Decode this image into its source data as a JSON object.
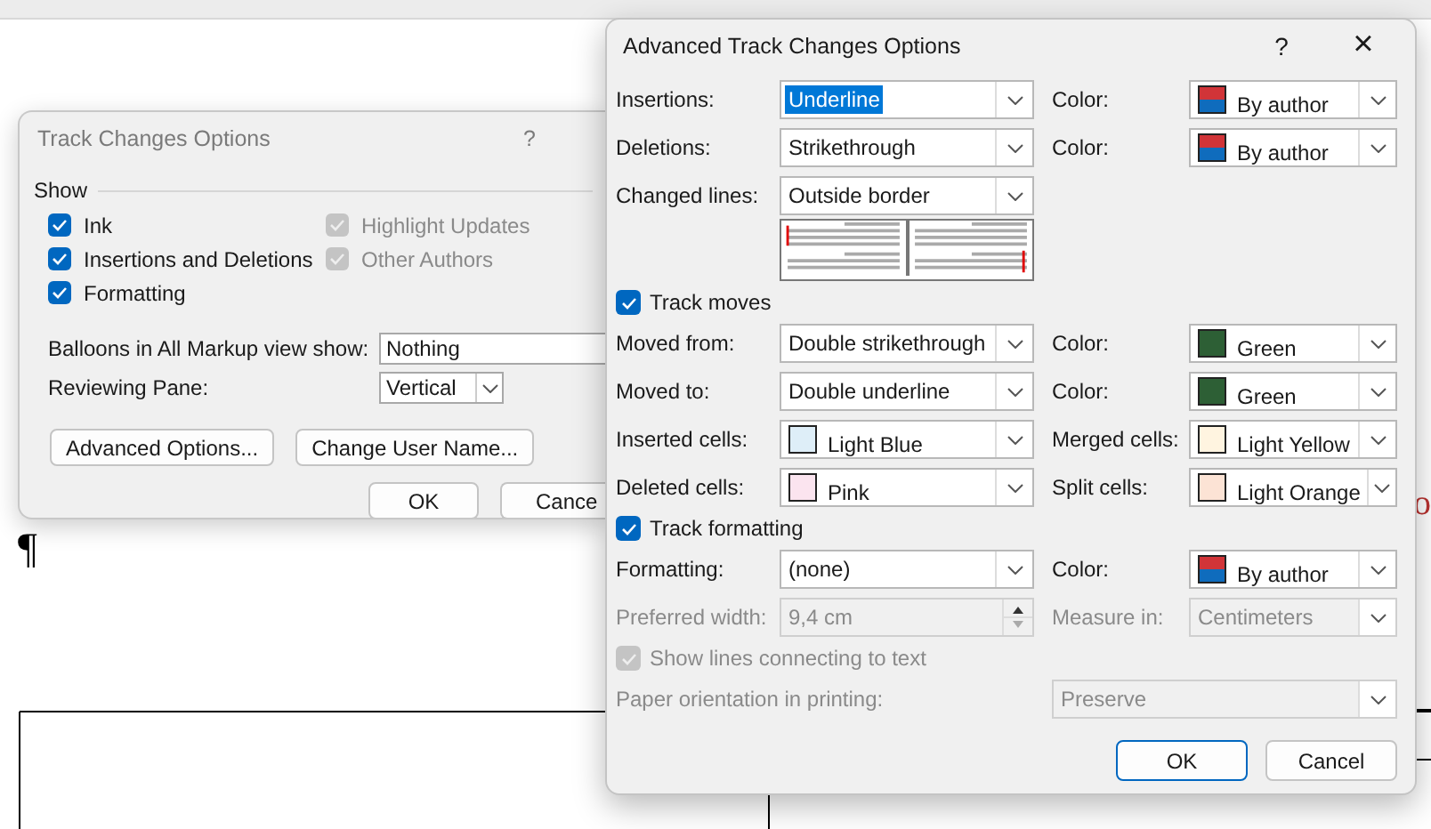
{
  "document": {
    "pilcrow": "¶",
    "fragment": "o"
  },
  "back_dialog": {
    "title": "Track Changes Options",
    "help": "?",
    "group": "Show",
    "checkboxes": [
      {
        "label": "Ink",
        "checked": true,
        "disabled": false
      },
      {
        "label": "Highlight Updates",
        "checked": true,
        "disabled": true
      },
      {
        "label": "Insertions and Deletions",
        "checked": true,
        "disabled": false
      },
      {
        "label": "Other Authors",
        "checked": true,
        "disabled": true
      },
      {
        "label": "Formatting",
        "checked": true,
        "disabled": false
      }
    ],
    "balloons": {
      "label": "Balloons in All Markup view show:",
      "value": "Nothing"
    },
    "reviewing_pane": {
      "label": "Reviewing Pane:",
      "value": "Vertical"
    },
    "buttons": [
      "Advanced Options...",
      "Change User Name..."
    ],
    "ok": "OK",
    "cancel": "Cance"
  },
  "dialog": {
    "title": "Advanced Track Changes Options",
    "help": "?",
    "close": "×",
    "rows": [
      {
        "kind": "pair",
        "disabled": false,
        "label": "Insertions:",
        "field": {
          "kind": "dropdown",
          "value": "Underline",
          "highlighted": true
        },
        "label2": "Color:",
        "field2": {
          "kind": "split-swatch",
          "value": "By author",
          "halves": [
            {
              "color": "#d13438"
            },
            {
              "color": "#0f6cbd"
            }
          ]
        }
      },
      {
        "kind": "pair",
        "disabled": false,
        "label": "Deletions:",
        "field": {
          "kind": "dropdown",
          "value": "Strikethrough",
          "highlighted": false
        },
        "label2": "Color:",
        "field2": {
          "kind": "split-swatch",
          "value": "By author",
          "halves": [
            {
              "color": "#d13438"
            },
            {
              "color": "#0f6cbd"
            }
          ]
        }
      },
      {
        "kind": "pair",
        "disabled": false,
        "label": "Changed lines:",
        "field": {
          "kind": "dropdown",
          "value": "Outside border",
          "highlighted": false
        }
      },
      {
        "kind": "preview"
      },
      {
        "kind": "checkbox",
        "label": "Track moves",
        "checked": true,
        "disabled": false
      },
      {
        "kind": "pair",
        "disabled": false,
        "label": "Moved from:",
        "field": {
          "kind": "dropdown",
          "value": "Double strikethrough",
          "highlighted": false
        },
        "label2": "Color:",
        "field2": {
          "kind": "swatch",
          "value": "Green",
          "color": "#2d5f35"
        }
      },
      {
        "kind": "pair",
        "disabled": false,
        "label": "Moved to:",
        "field": {
          "kind": "dropdown",
          "value": "Double underline",
          "highlighted": false
        },
        "label2": "Color:",
        "field2": {
          "kind": "swatch",
          "value": "Green",
          "color": "#2d5f35"
        }
      },
      {
        "kind": "pair",
        "disabled": false,
        "label": "Inserted cells:",
        "field": {
          "kind": "swatch",
          "value": "Light Blue",
          "color": "#deeef8",
          "highlighted": false
        },
        "label2": "Merged cells:",
        "field2": {
          "kind": "swatch",
          "value": "Light Yellow",
          "color": "#fff4e0"
        }
      },
      {
        "kind": "pair",
        "disabled": false,
        "label": "Deleted cells:",
        "field": {
          "kind": "swatch",
          "value": "Pink",
          "color": "#fbe4ef",
          "highlighted": false
        },
        "label2": "Split cells:",
        "field2": {
          "kind": "swatch",
          "value": "Light Orange",
          "color": "#fce3d5"
        }
      },
      {
        "kind": "checkbox",
        "label": "Track formatting",
        "checked": true,
        "disabled": false
      },
      {
        "kind": "pair",
        "disabled": false,
        "label": "Formatting:",
        "field": {
          "kind": "dropdown",
          "value": "(none)",
          "highlighted": false
        },
        "label2": "Color:",
        "field2": {
          "kind": "split-swatch",
          "value": "By author",
          "halves": [
            {
              "color": "#d13438"
            },
            {
              "color": "#0f6cbd"
            }
          ]
        }
      },
      {
        "kind": "pair",
        "disabled": true,
        "label": "Preferred width:",
        "field": {
          "kind": "spin",
          "value": "9,4 cm",
          "highlighted": false
        },
        "label2": "Measure in:",
        "field2": {
          "kind": "dropdown",
          "value": "Centimeters"
        }
      },
      {
        "kind": "checkbox",
        "label": "Show lines connecting to text",
        "checked": true,
        "disabled": true
      },
      {
        "kind": "wide",
        "disabled": true,
        "label": "Paper orientation in printing:",
        "field": {
          "kind": "dropdown",
          "value": "Preserve",
          "highlighted": false
        }
      }
    ],
    "buttons": [
      {
        "label": "OK",
        "default": true
      },
      {
        "label": "Cancel",
        "default": false
      }
    ]
  }
}
